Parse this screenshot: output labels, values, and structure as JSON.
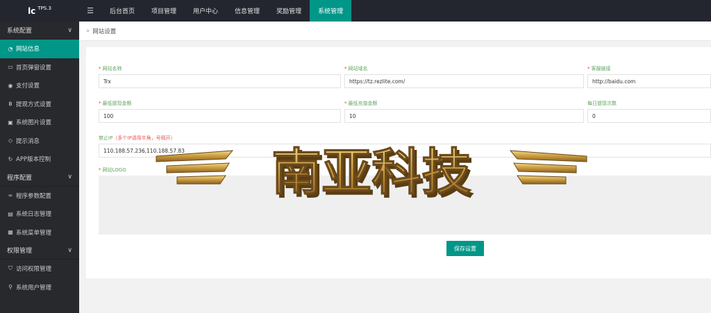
{
  "app": {
    "logo": "lc",
    "version": "TPS.3"
  },
  "topnav": {
    "menu_icon": "hamburger-icon",
    "tabs": [
      "后台首页",
      "项目管理",
      "用户中心",
      "信息管理",
      "奖励管理",
      "系统管理"
    ],
    "active_tab": "系统管理"
  },
  "sidebar": {
    "groups": [
      {
        "label": "系统配置",
        "items": [
          {
            "label": "网站信息",
            "icon": "dashboard-icon"
          },
          {
            "label": "首页弹窗设置",
            "icon": "popup-icon"
          },
          {
            "label": "支付设置",
            "icon": "circle-icon"
          },
          {
            "label": "提现方式设置",
            "icon": "bitcoin-icon"
          },
          {
            "label": "系统图片设置",
            "icon": "image-icon"
          },
          {
            "label": "提示消息",
            "icon": "tag-icon"
          },
          {
            "label": "APP版本控制",
            "icon": "refresh-icon"
          }
        ]
      },
      {
        "label": "程序配置",
        "items": [
          {
            "label": "程序参数配置",
            "icon": "link-icon"
          },
          {
            "label": "系统日志管理",
            "icon": "file-icon"
          },
          {
            "label": "系统菜单管理",
            "icon": "calendar-icon"
          }
        ]
      },
      {
        "label": "权限管理",
        "items": [
          {
            "label": "访问权限管理",
            "icon": "shield-icon"
          },
          {
            "label": "系统用户管理",
            "icon": "user-icon"
          }
        ]
      }
    ]
  },
  "breadcrumb": {
    "current": "网站设置"
  },
  "form": {
    "site_name": {
      "label": "网站名称",
      "value": "Trx"
    },
    "site_domain": {
      "label": "网站域名",
      "value": "https://tz.rezlite.com/"
    },
    "service_link": {
      "label": "客服链接",
      "value": "http://baidu.com"
    },
    "min_withdraw": {
      "label": "最低提现金额",
      "value": "100"
    },
    "min_recharge": {
      "label": "最低充值金额",
      "value": "10"
    },
    "daily_withdraw": {
      "label": "每日提现次数",
      "value": "0"
    },
    "ip_block": {
      "label": "禁止IP",
      "hint": "（多个IP请用半角，号隔开）",
      "value": "110.188.57.236,110.188.57.83"
    },
    "logo": {
      "label": "网站LOGO"
    },
    "save_label": "保存设置"
  },
  "watermark": {
    "text": "南亚科技"
  }
}
